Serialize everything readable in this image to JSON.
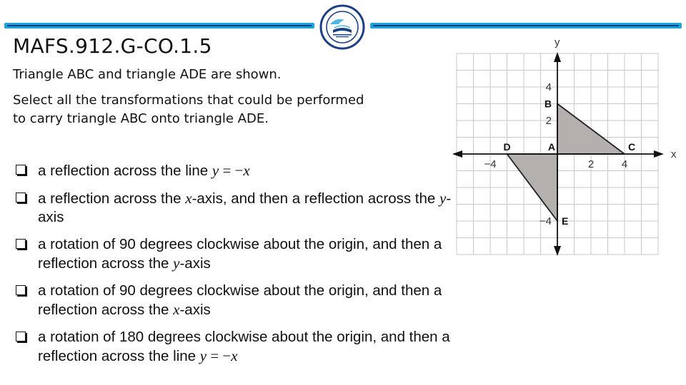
{
  "header": {
    "title": "MAFS.912.G-CO.1.5",
    "logo": "school-district-seal-logo",
    "accent_light": "#1ba3dc",
    "accent_dark": "#0b3a7e"
  },
  "prompt": {
    "line1": "Triangle ABC and triangle ADE are shown.",
    "line2": "Select all the transformations that could be performed to carry triangle ABC onto triangle ADE."
  },
  "options": [
    {
      "checked": false,
      "parts": [
        {
          "t": "a reflection across the line "
        },
        {
          "m": "y"
        },
        {
          "o": " = −"
        },
        {
          "m": "x"
        }
      ]
    },
    {
      "checked": false,
      "parts": [
        {
          "t": "a reflection across the "
        },
        {
          "m": "x"
        },
        {
          "t": "-axis, and then a reflection across the "
        },
        {
          "m": "y"
        },
        {
          "t": "-axis"
        }
      ]
    },
    {
      "checked": false,
      "parts": [
        {
          "t": "a rotation of 90 degrees clockwise about the origin, and then a reflection across the "
        },
        {
          "m": "y"
        },
        {
          "t": "-axis"
        }
      ]
    },
    {
      "checked": false,
      "parts": [
        {
          "t": "a rotation of 90 degrees clockwise about the origin, and then a reflection across the "
        },
        {
          "m": "x"
        },
        {
          "t": "-axis"
        }
      ]
    },
    {
      "checked": false,
      "parts": [
        {
          "t": "a rotation of 180 degrees clockwise about the origin, and then a reflection across the line "
        },
        {
          "m": "y"
        },
        {
          "o": " = −"
        },
        {
          "m": "x"
        }
      ]
    }
  ],
  "graph": {
    "x_axis_label": "x",
    "y_axis_label": "y",
    "x_range": [
      -6,
      6
    ],
    "y_range": [
      -6,
      6
    ],
    "grid_step": 1,
    "x_ticks": [
      {
        "value": -4,
        "label": "−4"
      },
      {
        "value": 2,
        "label": "2"
      },
      {
        "value": 4,
        "label": "4"
      }
    ],
    "y_ticks": [
      {
        "value": 4,
        "label": "4"
      },
      {
        "value": 2,
        "label": "2"
      },
      {
        "value": -4,
        "label": "−4"
      }
    ],
    "points": {
      "A": [
        0,
        0
      ],
      "B": [
        0,
        3
      ],
      "C": [
        4,
        0
      ],
      "D": [
        -3,
        0
      ],
      "E": [
        0,
        -4
      ]
    },
    "triangles": [
      {
        "name": "ABC",
        "vertices": [
          "A",
          "B",
          "C"
        ]
      },
      {
        "name": "ADE",
        "vertices": [
          "A",
          "D",
          "E"
        ]
      }
    ],
    "fill_color": "#b3b0ad",
    "grid_color": "#c8c8c8"
  }
}
